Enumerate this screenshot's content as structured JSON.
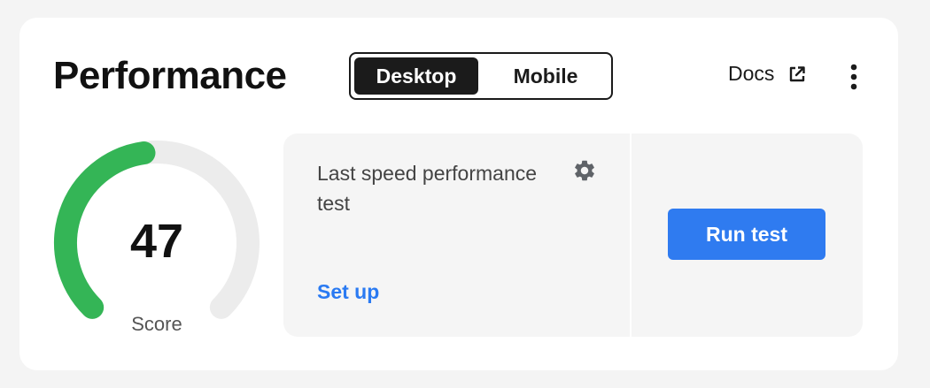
{
  "header": {
    "title": "Performance",
    "tabs": [
      {
        "label": "Desktop",
        "active": true
      },
      {
        "label": "Mobile",
        "active": false
      }
    ],
    "docs_label": "Docs",
    "docs_icon": "external-link-icon",
    "menu_icon": "more-vertical-icon"
  },
  "score": {
    "value": "47",
    "label": "Score",
    "fraction": 0.47,
    "color": "#34b556",
    "track_color": "#ececec"
  },
  "panel": {
    "last_test_text": "Last speed performance test",
    "settings_icon": "gear-icon",
    "setup_label": "Set up",
    "run_button_label": "Run test"
  },
  "colors": {
    "accent": "#2f7bf0",
    "link": "#2a7af2"
  }
}
